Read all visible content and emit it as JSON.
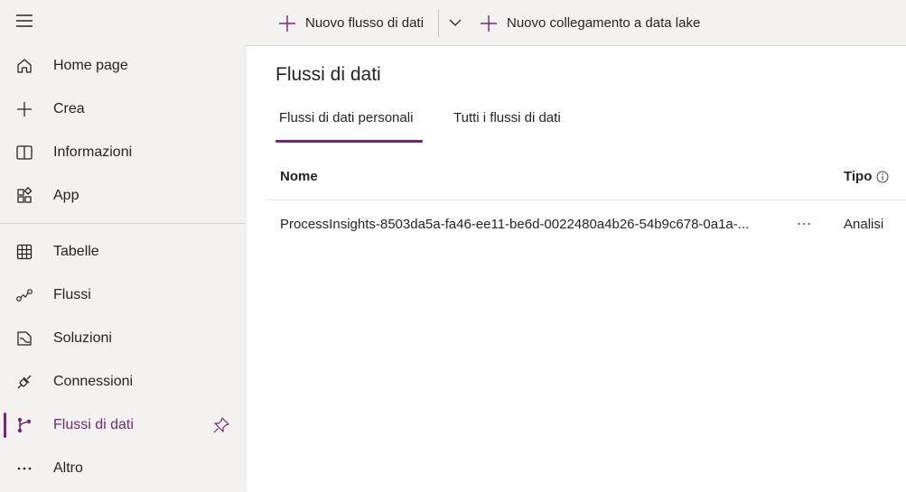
{
  "sidebar": {
    "items_top": [
      {
        "label": "Home page",
        "icon": "home-icon"
      },
      {
        "label": "Crea",
        "icon": "plus-icon"
      },
      {
        "label": "Informazioni",
        "icon": "book-icon"
      },
      {
        "label": "App",
        "icon": "apps-icon"
      }
    ],
    "items_bottom": [
      {
        "label": "Tabelle",
        "icon": "table-icon"
      },
      {
        "label": "Flussi",
        "icon": "flow-icon"
      },
      {
        "label": "Soluzioni",
        "icon": "solution-icon"
      },
      {
        "label": "Connessioni",
        "icon": "plug-icon"
      },
      {
        "label": "Flussi di dati",
        "icon": "dataflow-icon",
        "active": true
      },
      {
        "label": "Altro",
        "icon": "more-icon"
      }
    ]
  },
  "commandbar": {
    "new_dataflow": "Nuovo flusso di dati",
    "new_datalake_link": "Nuovo collegamento a data lake"
  },
  "main": {
    "title": "Flussi di dati",
    "tabs": [
      {
        "label": "Flussi di dati personali",
        "selected": true
      },
      {
        "label": "Tutti i flussi di dati",
        "selected": false
      }
    ],
    "table": {
      "columns": [
        "Nome",
        "Tipo"
      ],
      "rows": [
        {
          "name": "ProcessInsights-8503da5a-fa46-ee11-be6d-0022480a4b26-54b9c678-0a1a-...",
          "type": "Analisi"
        }
      ]
    }
  },
  "colors": {
    "accent": "#742774",
    "sidebar_bg": "#f3f2f1"
  }
}
